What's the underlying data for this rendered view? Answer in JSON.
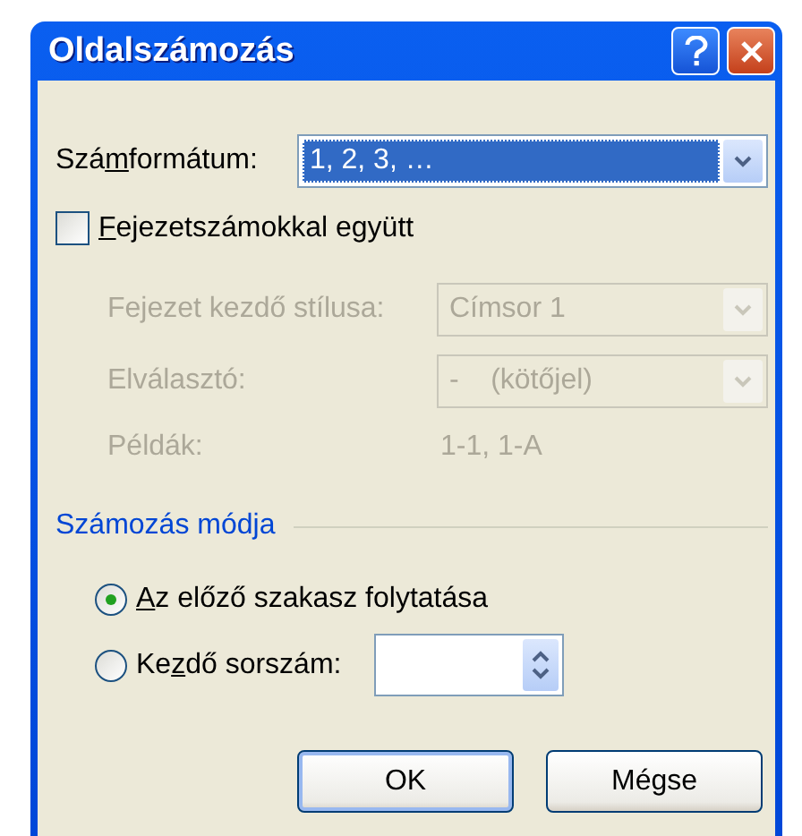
{
  "window": {
    "title": "Oldalszámozás"
  },
  "number_format": {
    "label": {
      "before": "Szá",
      "access_key": "m",
      "after": "formátum:"
    },
    "value": "1, 2, 3, …",
    "disabled": false
  },
  "include_chapter": {
    "label": {
      "access_key": "F",
      "after": "ejezetszámokkal együtt"
    },
    "checked": false
  },
  "chapter_style": {
    "label": "Fejezet kezdő stílusa:",
    "value": "Címsor 1",
    "disabled": true
  },
  "separator": {
    "label": "Elválasztó:",
    "value": "-    (kötőjel)",
    "disabled": true
  },
  "examples": {
    "label": "Példák:",
    "value": "1-1, 1-A",
    "disabled": true
  },
  "numbering_section": {
    "title": "Számozás módja"
  },
  "radios": [
    {
      "label": {
        "access_key": "A",
        "after": "z előző szakasz folytatása"
      },
      "selected": true
    },
    {
      "label": {
        "before": "Ke",
        "access_key": "z",
        "after": "dő sorszám:"
      },
      "selected": false
    }
  ],
  "buttons": [
    "OK",
    "Mégse"
  ]
}
